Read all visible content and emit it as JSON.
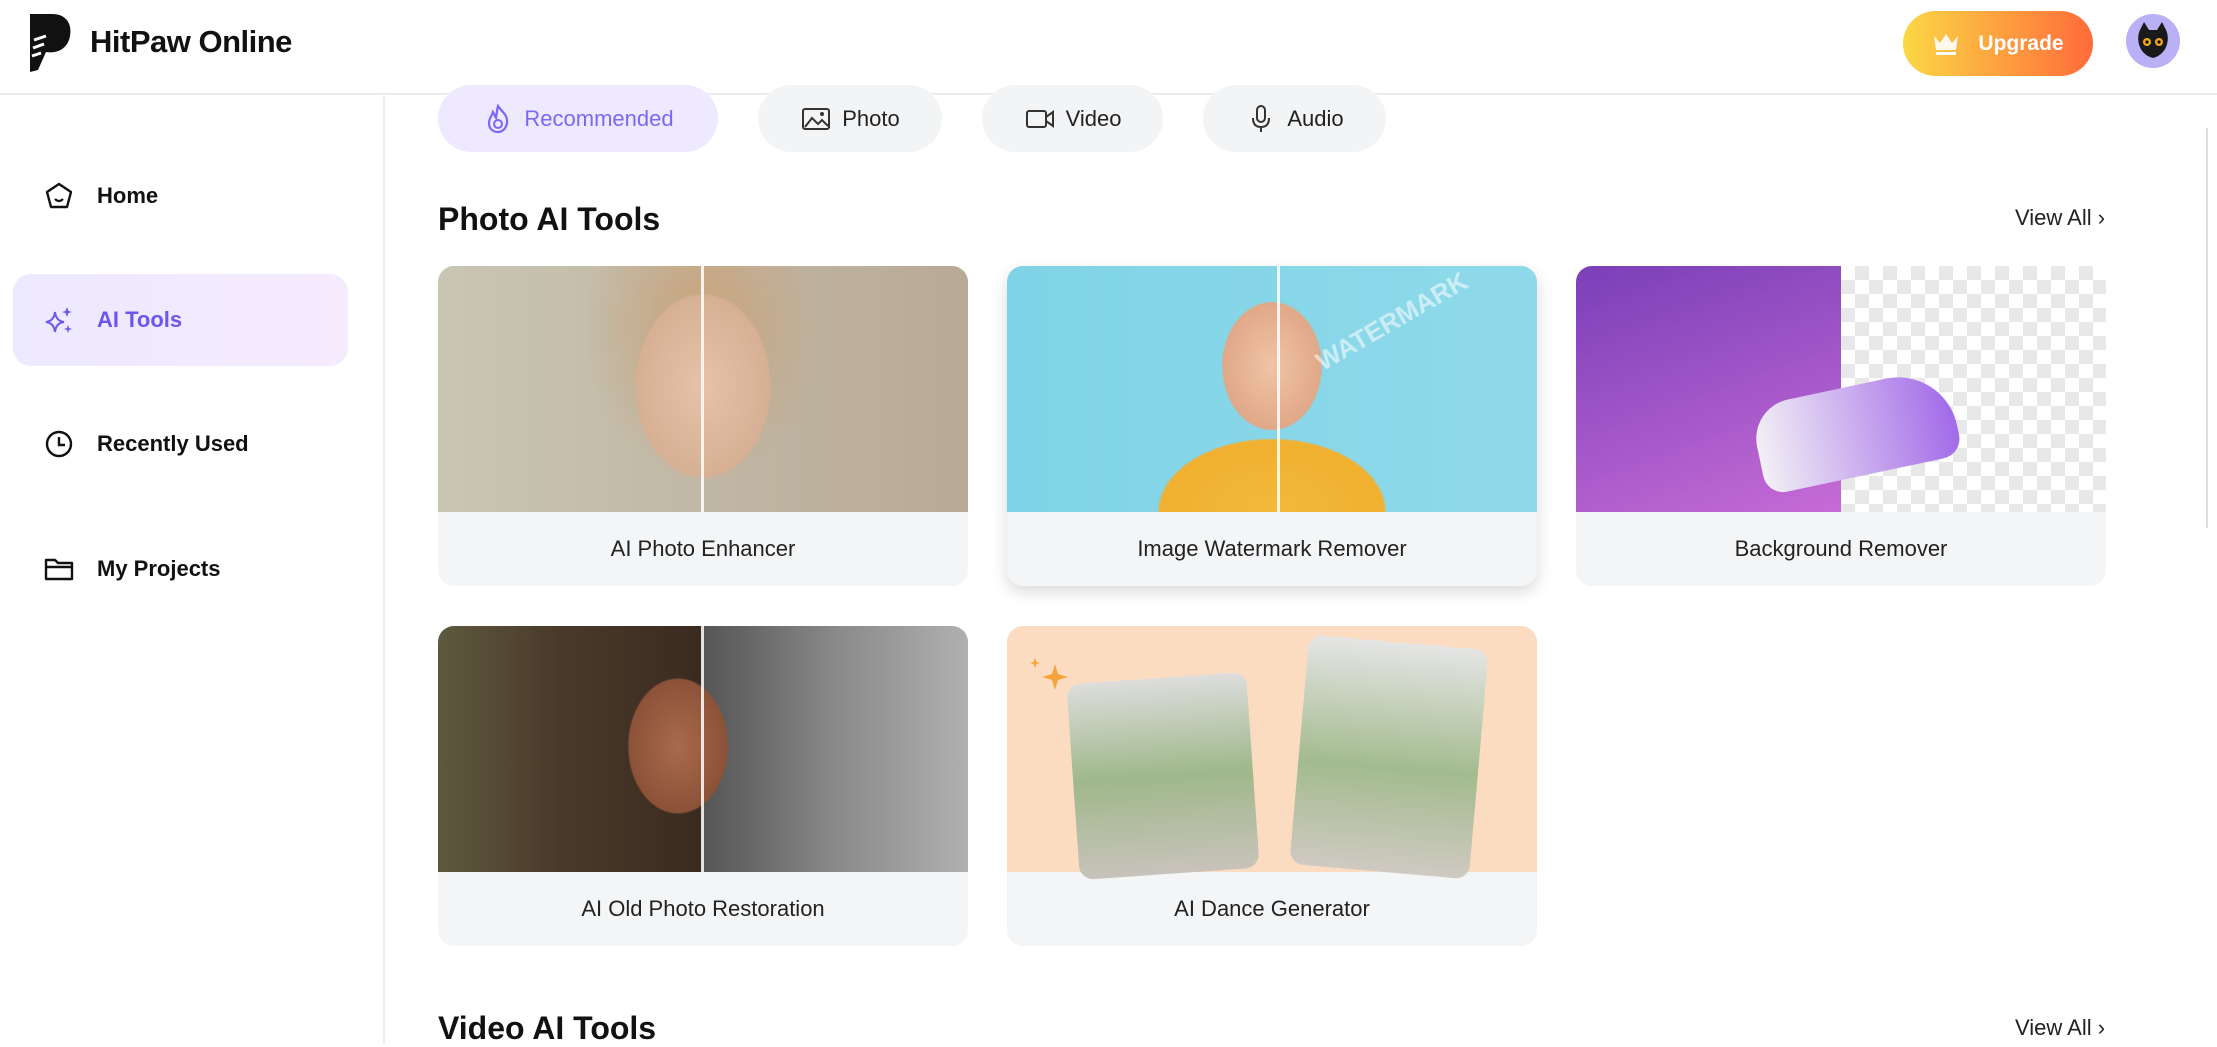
{
  "header": {
    "brand": "HitPaw Online",
    "upgrade_label": "Upgrade"
  },
  "sidebar": {
    "items": [
      {
        "label": "Home"
      },
      {
        "label": "AI Tools"
      },
      {
        "label": "Recently Used"
      },
      {
        "label": "My Projects"
      }
    ]
  },
  "tabs": [
    {
      "label": "Recommended"
    },
    {
      "label": "Photo"
    },
    {
      "label": "Video"
    },
    {
      "label": "Audio"
    }
  ],
  "sections": [
    {
      "title": "Photo AI Tools",
      "view_all": "View All",
      "cards": [
        {
          "label": "AI Photo Enhancer"
        },
        {
          "label": "Image Watermark Remover",
          "watermark": "WATERMARK"
        },
        {
          "label": "Background Remover"
        },
        {
          "label": "AI Old Photo Restoration"
        },
        {
          "label": "AI Dance Generator"
        }
      ]
    },
    {
      "title": "Video AI Tools",
      "view_all": "View All"
    }
  ],
  "colors": {
    "accent": "#6b57f0",
    "upgrade_start": "#fbd845",
    "upgrade_end": "#ff6b3a"
  }
}
